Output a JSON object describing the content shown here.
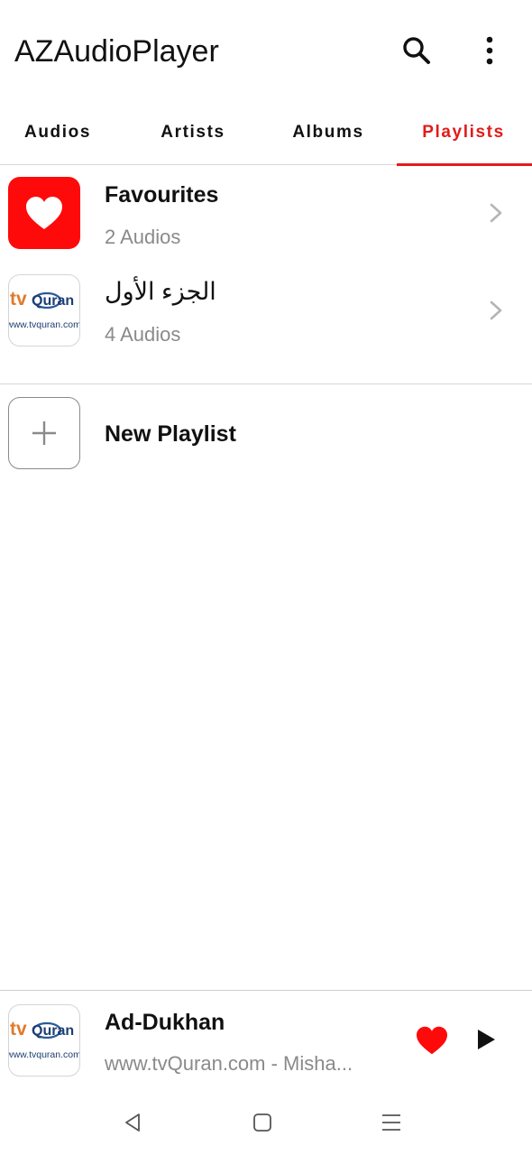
{
  "app": {
    "title": "AZAudioPlayer"
  },
  "appbar": {
    "search_icon": "search-icon",
    "menu_icon": "more-vert-icon"
  },
  "tabs": [
    {
      "label": "Audios",
      "active": false
    },
    {
      "label": "Artists",
      "active": false
    },
    {
      "label": "Albums",
      "active": false
    },
    {
      "label": "Playlists",
      "active": true
    }
  ],
  "playlists": [
    {
      "title": "Favourites",
      "subtitle": "2 Audios",
      "thumb": "heart-icon",
      "color": "#ff0a0a"
    },
    {
      "title": "الجزء الأول",
      "subtitle": "4 Audios",
      "thumb": "tvquran-logo"
    }
  ],
  "tvquran_logo": {
    "tv": "tv",
    "quran": "Quran",
    "url": "www.tvquran.com"
  },
  "new_playlist": {
    "label": "New Playlist",
    "icon": "plus-icon"
  },
  "mini_player": {
    "title": "Ad-Dukhan",
    "subtitle": "www.tvQuran.com - Misha...",
    "favorite_icon": "heart-icon",
    "play_icon": "play-icon"
  },
  "navbar": {
    "back_icon": "back-icon",
    "home_icon": "home-icon",
    "recents_icon": "recents-icon"
  },
  "colors": {
    "accent": "#e31b1b",
    "heart": "#ff0a0a",
    "text": "#111111",
    "subtext": "#8a8a8a"
  }
}
